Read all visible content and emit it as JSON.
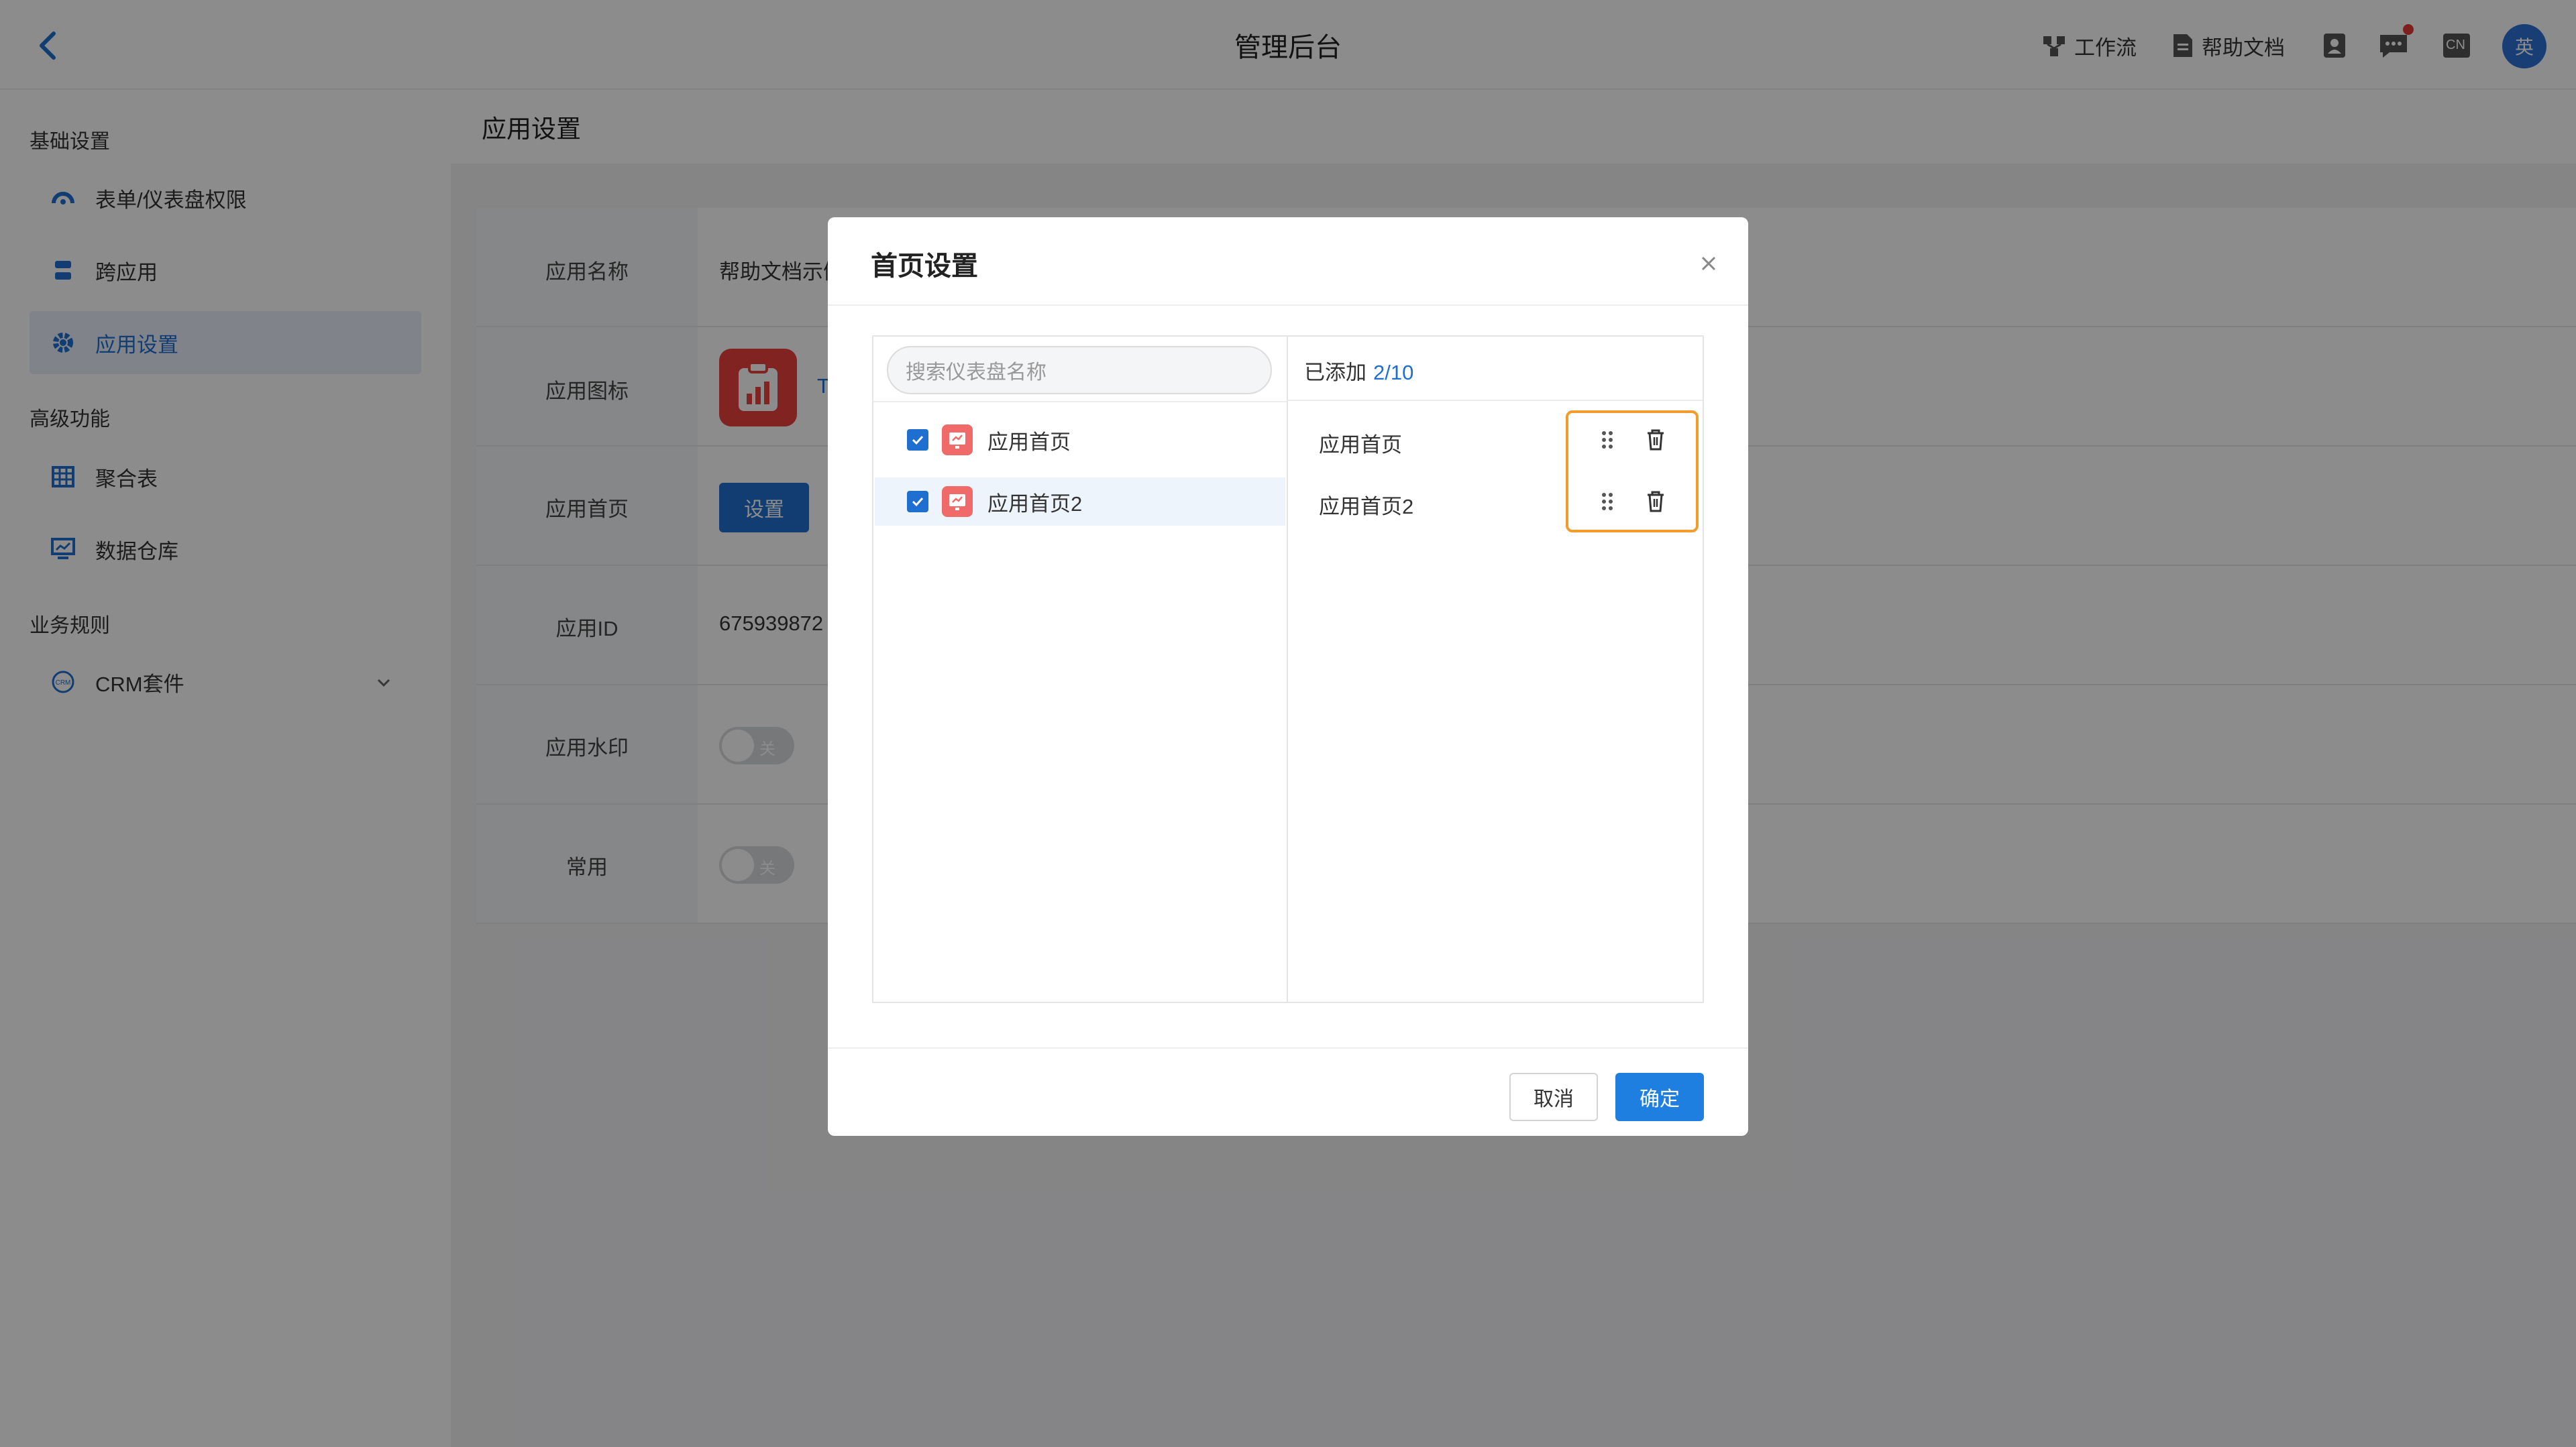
{
  "header": {
    "title": "管理后台",
    "workflow_label": "工作流",
    "help_docs_label": "帮助文档",
    "lang_badge": "CN",
    "avatar_text": "英"
  },
  "sidebar": {
    "groups": [
      {
        "title": "基础设置",
        "items": [
          {
            "label": "表单/仪表盘权限",
            "icon": "dashboard-icon"
          },
          {
            "label": "跨应用",
            "icon": "cross-app-icon"
          },
          {
            "label": "应用设置",
            "icon": "gear-icon",
            "active": true
          }
        ]
      },
      {
        "title": "高级功能",
        "items": [
          {
            "label": "聚合表",
            "icon": "table-icon"
          },
          {
            "label": "数据仓库",
            "icon": "monitor-icon"
          }
        ]
      },
      {
        "title": "业务规则",
        "items": [
          {
            "label": "CRM套件",
            "icon": "crm-icon",
            "expandable": true
          }
        ]
      }
    ]
  },
  "main": {
    "title": "应用设置",
    "rows": [
      {
        "label": "应用名称",
        "value": "帮助文档示例"
      },
      {
        "label": "应用图标",
        "value": "T"
      },
      {
        "label": "应用首页",
        "button": "设置"
      },
      {
        "label": "应用ID",
        "value": "675939872"
      },
      {
        "label": "应用水印",
        "toggle_text": "关"
      },
      {
        "label": "常用",
        "toggle_text": "关"
      }
    ]
  },
  "modal": {
    "title": "首页设置",
    "search_placeholder": "搜索仪表盘名称",
    "added_label": "已添加",
    "added_count": "2/10",
    "left_items": [
      {
        "label": "应用首页",
        "checked": true
      },
      {
        "label": "应用首页2",
        "checked": true
      }
    ],
    "right_items": [
      {
        "label": "应用首页"
      },
      {
        "label": "应用首页2"
      }
    ],
    "cancel_label": "取消",
    "ok_label": "确定"
  },
  "colors": {
    "primary": "#1f6fd0",
    "highlight_border": "#f39c2e",
    "dashboard_icon": "#f06a6a",
    "app_icon": "#e9403d"
  }
}
